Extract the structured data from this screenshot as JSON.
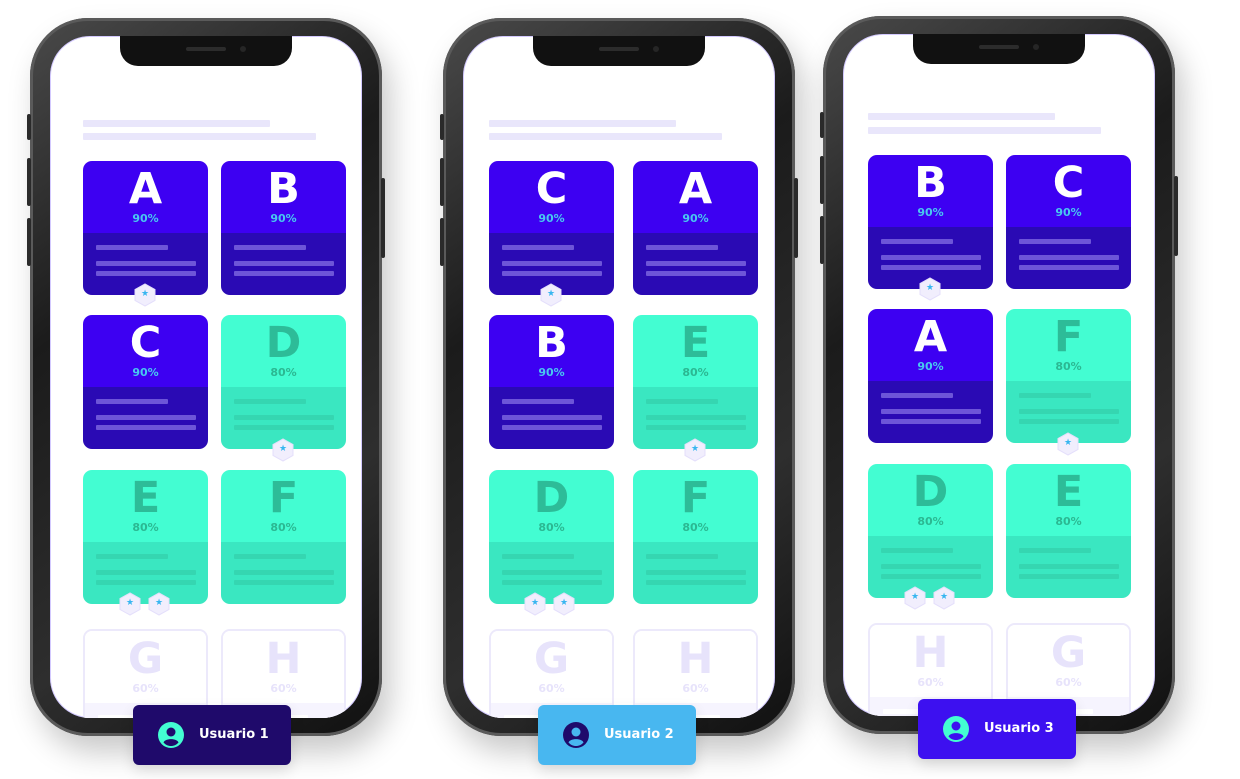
{
  "colors": {
    "purple_top": "#3d00f2",
    "purple_bottom": "#2a0ab4",
    "teal_top": "#43fdd2",
    "teal_bottom": "#3ae7c1",
    "faded": "#e7e3fb",
    "badge_star": "#38b6f0"
  },
  "phones": [
    {
      "user_label": "Usuario 1",
      "cards": [
        {
          "letter": "A",
          "percent": "90%",
          "style": "purple"
        },
        {
          "letter": "B",
          "percent": "90%",
          "style": "purple"
        },
        {
          "letter": "C",
          "percent": "90%",
          "style": "purple"
        },
        {
          "letter": "D",
          "percent": "80%",
          "style": "teal"
        },
        {
          "letter": "E",
          "percent": "80%",
          "style": "teal"
        },
        {
          "letter": "F",
          "percent": "80%",
          "style": "teal"
        },
        {
          "letter": "G",
          "percent": "60%",
          "style": "faded"
        },
        {
          "letter": "H",
          "percent": "60%",
          "style": "faded"
        }
      ]
    },
    {
      "user_label": "Usuario 2",
      "cards": [
        {
          "letter": "C",
          "percent": "90%",
          "style": "purple"
        },
        {
          "letter": "A",
          "percent": "90%",
          "style": "purple"
        },
        {
          "letter": "B",
          "percent": "90%",
          "style": "purple"
        },
        {
          "letter": "E",
          "percent": "80%",
          "style": "teal"
        },
        {
          "letter": "D",
          "percent": "80%",
          "style": "teal"
        },
        {
          "letter": "F",
          "percent": "80%",
          "style": "teal"
        },
        {
          "letter": "G",
          "percent": "60%",
          "style": "faded"
        },
        {
          "letter": "H",
          "percent": "60%",
          "style": "faded"
        }
      ]
    },
    {
      "user_label": "Usuario 3",
      "cards": [
        {
          "letter": "B",
          "percent": "90%",
          "style": "purple"
        },
        {
          "letter": "C",
          "percent": "90%",
          "style": "purple"
        },
        {
          "letter": "A",
          "percent": "90%",
          "style": "purple"
        },
        {
          "letter": "F",
          "percent": "80%",
          "style": "teal"
        },
        {
          "letter": "D",
          "percent": "80%",
          "style": "teal"
        },
        {
          "letter": "E",
          "percent": "80%",
          "style": "teal"
        },
        {
          "letter": "H",
          "percent": "60%",
          "style": "faded"
        },
        {
          "letter": "G",
          "percent": "60%",
          "style": "faded"
        }
      ]
    }
  ],
  "icons": {
    "badge": "star-hexagon-icon",
    "avatar": "user-avatar-icon"
  }
}
